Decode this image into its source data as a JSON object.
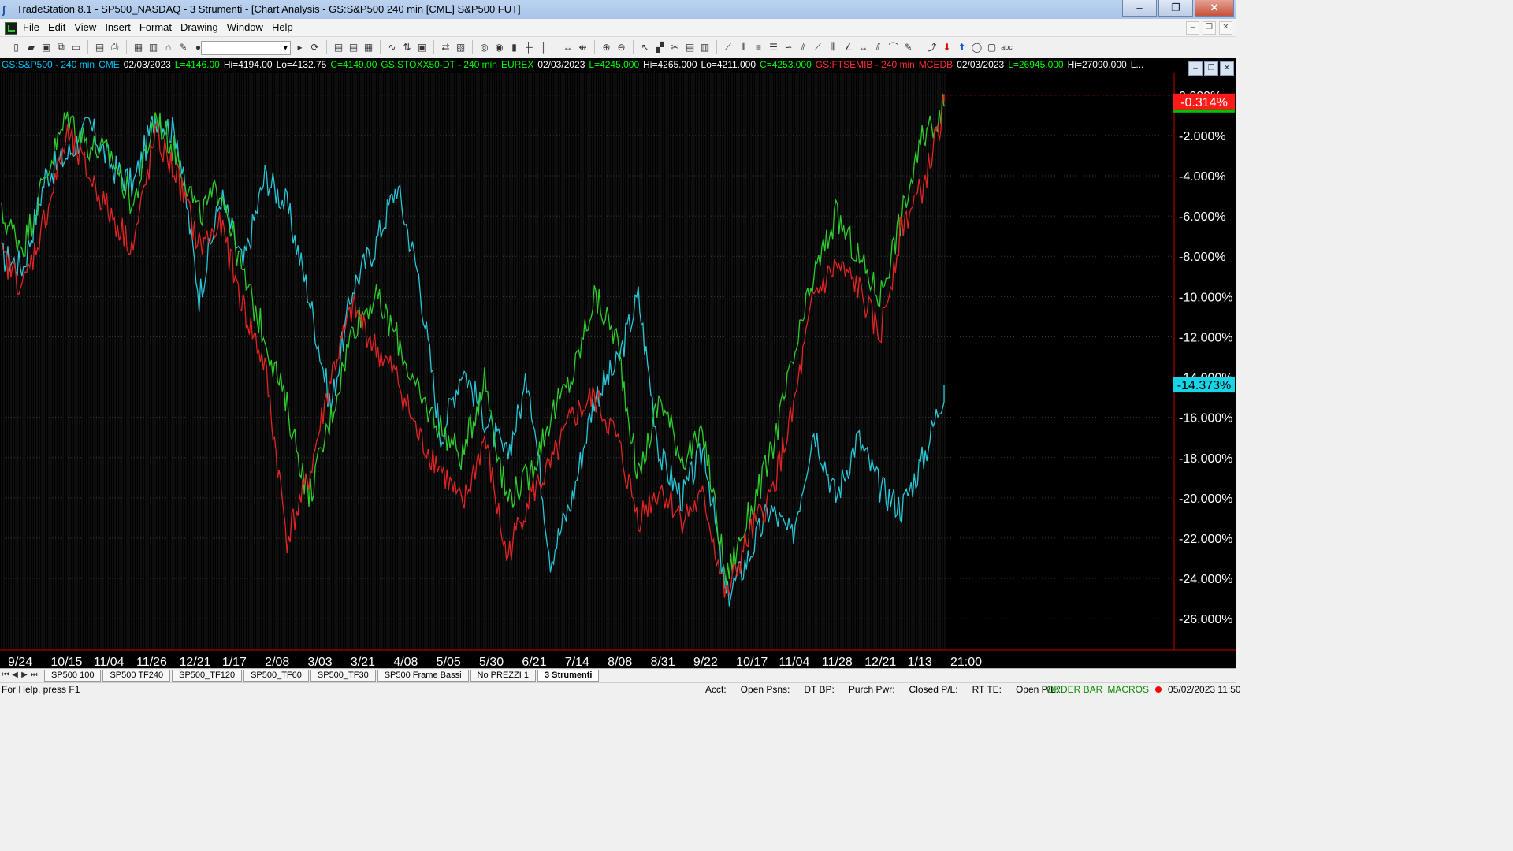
{
  "window": {
    "title": "TradeStation 8.1 - SP500_NASDAQ - 3 Strumenti - [Chart Analysis - GS:S&P500  240 min  [CME] S&P500 FUT]",
    "buttons": {
      "minimize": "–",
      "restore": "❐",
      "close": "✕"
    }
  },
  "menu": {
    "items": [
      "File",
      "Edit",
      "View",
      "Insert",
      "Format",
      "Drawing",
      "Window",
      "Help"
    ],
    "mdi": {
      "minimize": "–",
      "restore": "❐",
      "close": "✕"
    }
  },
  "toolbar": {
    "combo_value": "",
    "icons": [
      "new-icon",
      "open-icon",
      "save-icon",
      "copy-icon",
      "folder-icon",
      "print-preview-icon",
      "print-icon",
      "workspace-icon",
      "window-icon",
      "lock-icon",
      "analysis-icon",
      "link-icon",
      "refresh-icon",
      "chart-type-icon",
      "data-icon",
      "bar-icon",
      "candle-icon",
      "zoom-in-icon",
      "zoom-out-icon",
      "pointer-icon",
      "drawing-icon",
      "tools-icon",
      "line-icon",
      "ray-icon",
      "ellipse-icon",
      "rectangle-icon",
      "text-icon"
    ]
  },
  "chart": {
    "header": [
      {
        "text": "GS:S&P500 - 240 min",
        "color": "#00c8ff"
      },
      {
        "text": "CME",
        "color": "#00c8ff"
      },
      {
        "text": "02/03/2023",
        "color": "#ffffff"
      },
      {
        "text": "L=4146.00",
        "color": "#00ff00"
      },
      {
        "text": "Hi=4194.00",
        "color": "#ffffff"
      },
      {
        "text": "Lo=4132.75",
        "color": "#ffffff"
      },
      {
        "text": "C=4149.00",
        "color": "#00ff00"
      },
      {
        "text": "GS:STOXX50-DT - 240 min",
        "color": "#00ff00"
      },
      {
        "text": "EUREX",
        "color": "#00ff00"
      },
      {
        "text": "02/03/2023",
        "color": "#ffffff"
      },
      {
        "text": "L=4245.000",
        "color": "#00ff00"
      },
      {
        "text": "Hi=4265.000",
        "color": "#ffffff"
      },
      {
        "text": "Lo=4211.000",
        "color": "#ffffff"
      },
      {
        "text": "C=4253.000",
        "color": "#00ff00"
      },
      {
        "text": "GS:FTSEMIB - 240 min",
        "color": "#ff3030"
      },
      {
        "text": "MCEDB",
        "color": "#ff3030"
      },
      {
        "text": "02/03/2023",
        "color": "#ffffff"
      },
      {
        "text": "L=26945.000",
        "color": "#00ff00"
      },
      {
        "text": "Hi=27090.000",
        "color": "#ffffff"
      },
      {
        "text": "L...",
        "color": "#ffffff"
      }
    ],
    "colors": {
      "spx": "#29c6d6",
      "stoxx": "#2ecc2e",
      "ftse": "#e02424",
      "background": "#000000",
      "axis_text": "#ffffff"
    }
  },
  "chart_data": {
    "type": "line",
    "title": "",
    "xlabel": "",
    "ylabel": "",
    "ylim": [
      -26.5,
      0.5
    ],
    "y_ticks": [
      "0.000%",
      "-2.000%",
      "-4.000%",
      "-6.000%",
      "-8.000%",
      "-10.000%",
      "-12.000%",
      "-14.000%",
      "-16.000%",
      "-18.000%",
      "-20.000%",
      "-22.000%",
      "-24.000%",
      "-26.000%"
    ],
    "x_ticks": [
      "9/24",
      "10/15",
      "11/04",
      "11/26",
      "12/21",
      "1/17",
      "2/08",
      "3/03",
      "3/21",
      "4/08",
      "5/05",
      "5/30",
      "6/21",
      "7/14",
      "8/08",
      "8/31",
      "9/22",
      "10/17",
      "11/04",
      "11/28",
      "12/21",
      "1/13",
      "21:00"
    ],
    "last_labels": [
      {
        "series": "GS:FTSEMIB",
        "value": "-0.314%"
      },
      {
        "series": "GS:S&P500",
        "value": "-14.373%"
      }
    ],
    "series": [
      {
        "name": "GS:S&P500",
        "values": [
          -8.0,
          -8.5,
          -4.0,
          -3.0,
          -1.5,
          -3.5,
          -4.5,
          -1.0,
          -2.0,
          -10.0,
          -5.0,
          -8.5,
          -4.0,
          -5.5,
          -10.0,
          -15.5,
          -9.5,
          -7.5,
          -4.5,
          -9.0,
          -17.0,
          -13.5,
          -16.0,
          -18.0,
          -14.0,
          -23.0,
          -20.0,
          -15.0,
          -13.5,
          -10.0,
          -18.0,
          -20.0,
          -17.5,
          -25.0,
          -23.0,
          -20.5,
          -22.0,
          -16.5,
          -20.0,
          -17.0,
          -19.5,
          -20.5,
          -18.0,
          -14.373
        ]
      },
      {
        "name": "GS:STOXX50-DT",
        "values": [
          -6.0,
          -7.5,
          -4.0,
          -1.0,
          -2.5,
          -3.0,
          -5.5,
          -1.0,
          -3.0,
          -6.0,
          -4.5,
          -9.0,
          -12.0,
          -15.5,
          -20.0,
          -16.0,
          -11.5,
          -10.0,
          -12.0,
          -15.0,
          -16.5,
          -18.0,
          -14.0,
          -20.0,
          -19.0,
          -16.0,
          -14.0,
          -10.0,
          -12.0,
          -19.0,
          -15.0,
          -18.0,
          -17.0,
          -24.0,
          -21.0,
          -18.0,
          -13.5,
          -9.0,
          -6.0,
          -8.0,
          -10.0,
          -6.0,
          -2.0,
          -0.5
        ]
      },
      {
        "name": "GS:FTSEMIB",
        "values": [
          -8.0,
          -9.5,
          -6.0,
          -2.0,
          -4.0,
          -6.0,
          -7.5,
          -2.0,
          -4.0,
          -7.5,
          -6.5,
          -10.5,
          -13.5,
          -22.0,
          -19.0,
          -14.0,
          -10.5,
          -12.5,
          -14.0,
          -17.0,
          -18.5,
          -20.5,
          -17.0,
          -23.0,
          -20.0,
          -18.5,
          -16.0,
          -15.0,
          -17.0,
          -21.0,
          -19.5,
          -21.0,
          -20.0,
          -25.0,
          -22.0,
          -20.0,
          -16.0,
          -10.0,
          -8.5,
          -9.5,
          -12.0,
          -6.5,
          -4.5,
          -0.314
        ]
      }
    ]
  },
  "tabs": {
    "items": [
      "SP500 100",
      "SP500 TF240",
      "SP500_TF120",
      "SP500_TF60",
      "SP500_TF30",
      "SP500 Frame Bassi",
      "No PREZZI 1",
      "3 Strumenti"
    ],
    "active_index": 7
  },
  "status": {
    "help": "For Help, press F1",
    "fields": [
      "Acct:",
      "Open Psns:",
      "DT BP:",
      "Purch Pwr:",
      "Closed P/L:",
      "RT TE:",
      "Open P/L:"
    ],
    "order_bar": "ORDER BAR",
    "macros": "MACROS",
    "datetime": "05/02/2023 11:50"
  }
}
